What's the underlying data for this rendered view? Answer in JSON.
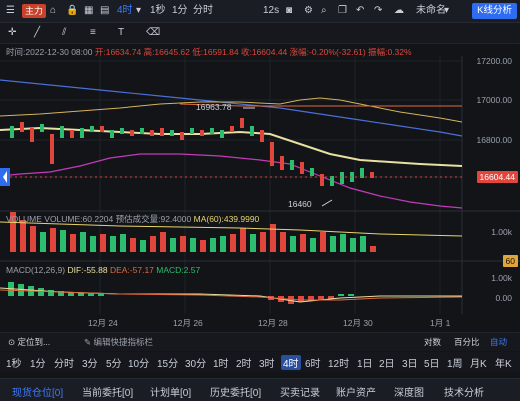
{
  "toolbar": {
    "main_badge": "主力",
    "period": "4时",
    "one_sec": "1秒",
    "one_min": "1分",
    "timeshare": "分时",
    "seconds": "12s",
    "unnamed": "未命名",
    "kline_btn": "K线分析"
  },
  "info": {
    "time": "时间:2022-12-30 08:00",
    "open": "开:16634.74",
    "high": "高:16645.62",
    "low": "低:16591.84",
    "close": "收:16604.44",
    "change": "涨幅:-0.20%(-32.61)",
    "amp": "振幅:0.32%"
  },
  "price_axis": [
    "17200.00",
    "17000.00",
    "16800.00",
    "16600.00"
  ],
  "current_price": "16604.44",
  "annotations": {
    "high": "16963.78",
    "low": "16460"
  },
  "volume": {
    "label": "VOLUME",
    "value": "VOLUME:60.2204",
    "est": "预估成交量:92.4000",
    "ma": "MA(60):439.9990",
    "axis_top": "1.00k",
    "axis_tag": "60"
  },
  "macd": {
    "label": "MACD(12,26,9)",
    "dif": "DIF:-55.88",
    "dea": "DEA:-57.17",
    "macd": "MACD:2.57",
    "axis_top": "1.00k",
    "axis_bottom": "0.00"
  },
  "dates": [
    "12月 24",
    "12月 26",
    "12月 28",
    "12月 30",
    "1月 1"
  ],
  "actions": {
    "locate": "定位到...",
    "edit": "编辑快捷指标栏",
    "abs": "对数",
    "pct": "百分比",
    "auto": "自动"
  },
  "timeframes": [
    "1秒",
    "1分",
    "分时",
    "3分",
    "5分",
    "10分",
    "15分",
    "30分",
    "1时",
    "2时",
    "3时",
    "4时",
    "6时",
    "12时",
    "1日",
    "2日",
    "3日",
    "5日",
    "1周",
    "月K",
    "年K"
  ],
  "selected_timeframe": "4时",
  "tabs": [
    "现货仓位[0]",
    "当前委托[0]",
    "计划单[0]",
    "历史委托[0]",
    "买卖记录",
    "账户资产",
    "深度图",
    "技术分析"
  ],
  "colors": {
    "up": "#2dbd6e",
    "down": "#e0463c",
    "accent": "#2f6df0"
  }
}
